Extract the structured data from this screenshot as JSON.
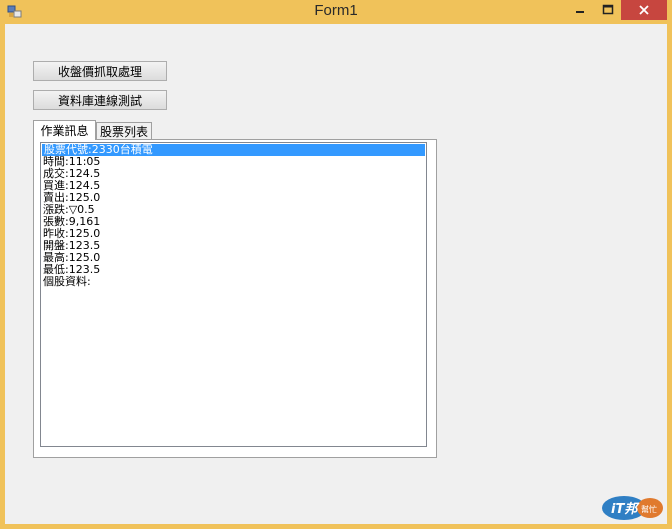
{
  "window": {
    "title": "Form1"
  },
  "buttons": {
    "fetch_label": "收盤價抓取處理",
    "db_test_label": "資料庫連線測試"
  },
  "tabs": [
    {
      "label": "作業訊息",
      "active": true
    },
    {
      "label": "股票列表",
      "active": false
    }
  ],
  "list": {
    "items": [
      "股票代號:2330台積電",
      "時間:11:05",
      "成交:124.5",
      "買進:124.5",
      "賣出:125.0",
      "漲跌:▽0.5",
      "張數:9,161",
      "昨收:125.0",
      "開盤:123.5",
      "最高:125.0",
      "最低:123.5",
      "個股資料:"
    ],
    "selected_index": 0
  },
  "watermark": {
    "text": "iT邦幫忙"
  },
  "colors": {
    "titlebar": "#f0c25a",
    "close_button": "#c7463f",
    "selection": "#3399ff"
  }
}
